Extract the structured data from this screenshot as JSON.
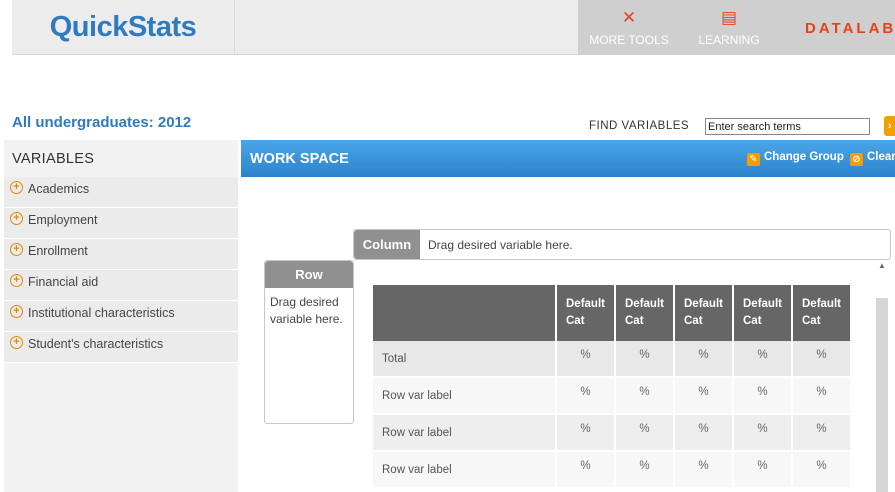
{
  "header": {
    "logo_text": "QuickStats",
    "more_tools_label": "MORE TOOLS",
    "learning_label": "LEARNING",
    "datalab_label": "DATALAB",
    "accent_color": "#e2431a"
  },
  "dataset": {
    "title": "All undergraduates: 2012"
  },
  "search": {
    "label": "FIND VARIABLES",
    "value": "Enter search terms"
  },
  "sidebar": {
    "title": "VARIABLES",
    "items": [
      {
        "label": "Academics"
      },
      {
        "label": "Employment"
      },
      {
        "label": "Enrollment"
      },
      {
        "label": "Financial aid"
      },
      {
        "label": "Institutional characteristics"
      },
      {
        "label": "Student's characteristics"
      }
    ]
  },
  "workspace": {
    "title": "WORK SPACE",
    "change_group_label": "Change Group",
    "clear_label": "Clear",
    "column_tab": "Column",
    "column_hint": "Drag desired variable here.",
    "row_tab": "Row",
    "row_hint": "Drag desired variable here."
  },
  "table": {
    "columns": [
      "Default Cat",
      "Default Cat",
      "Default Cat",
      "Default Cat",
      "Default Cat"
    ],
    "rows": [
      {
        "label": "Total",
        "values": [
          "%",
          "%",
          "%",
          "%",
          "%"
        ]
      },
      {
        "label": "Row var label",
        "values": [
          "%",
          "%",
          "%",
          "%",
          "%"
        ]
      },
      {
        "label": "Row var label",
        "values": [
          "%",
          "%",
          "%",
          "%",
          "%"
        ]
      },
      {
        "label": "Row var label",
        "values": [
          "%",
          "%",
          "%",
          "%",
          "%"
        ]
      }
    ]
  }
}
